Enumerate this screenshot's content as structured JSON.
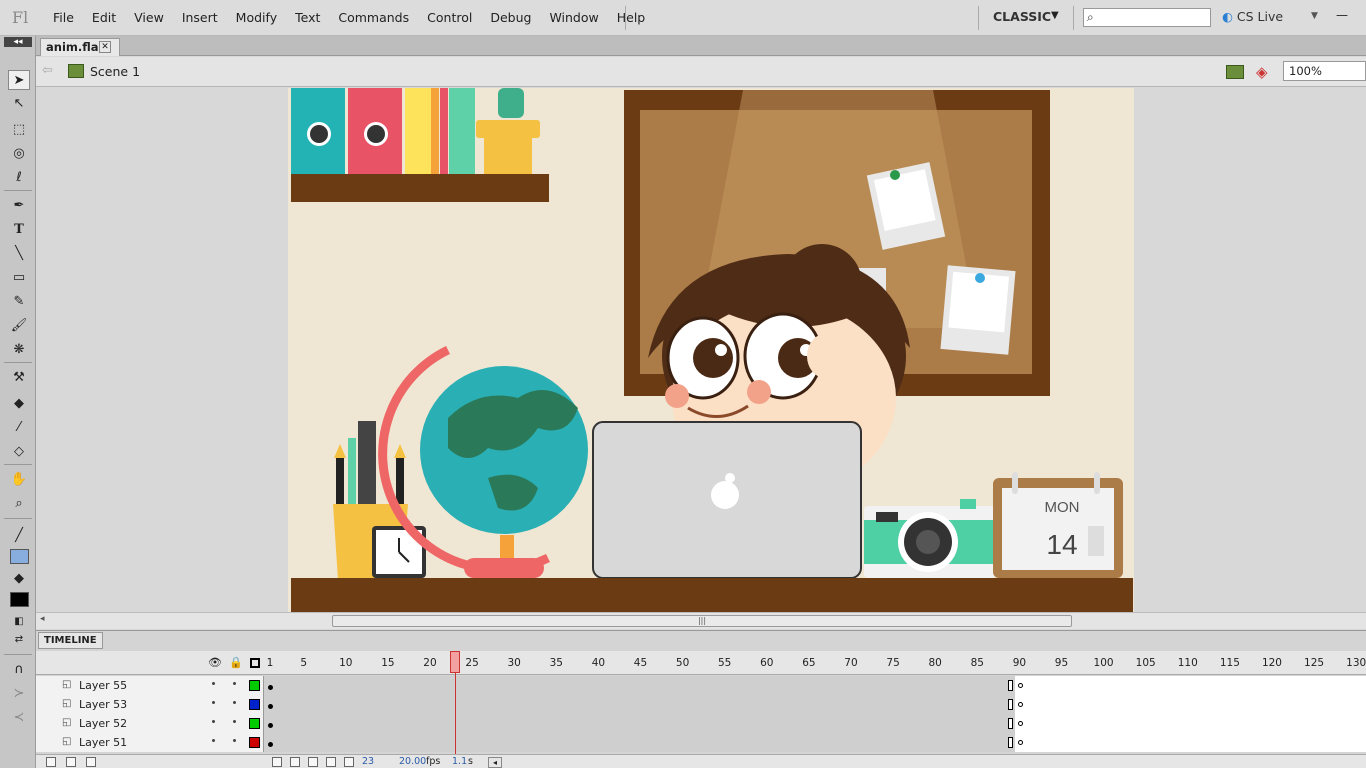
{
  "app": {
    "logo": "Fl"
  },
  "menu": [
    "File",
    "Edit",
    "View",
    "Insert",
    "Modify",
    "Text",
    "Commands",
    "Control",
    "Debug",
    "Window",
    "Help"
  ],
  "workspace": {
    "label": "CLASSIC"
  },
  "cslive": {
    "label": "CS Live"
  },
  "document": {
    "tab": "anim.fla"
  },
  "editbar": {
    "scene": "Scene 1",
    "zoom": "100%"
  },
  "stage_art": {
    "calendar_day": "MON",
    "calendar_date": "14"
  },
  "timeline": {
    "tab": "TIMELINE",
    "ruler": [
      "1",
      "5",
      "10",
      "15",
      "20",
      "25",
      "30",
      "35",
      "40",
      "45",
      "50",
      "55",
      "60",
      "65",
      "70",
      "75",
      "80",
      "85",
      "90",
      "95",
      "100",
      "105",
      "110",
      "115",
      "120",
      "125",
      "130"
    ],
    "layers": [
      {
        "name": "Layer 55",
        "color": "#00cc00"
      },
      {
        "name": "Layer 53",
        "color": "#0022cc"
      },
      {
        "name": "Layer 52",
        "color": "#00cc00"
      },
      {
        "name": "Layer 51",
        "color": "#cc0000"
      }
    ],
    "current_frame": "23",
    "fps": "20.00",
    "fps_unit": "fps",
    "time": "1.1",
    "time_unit": "s"
  }
}
